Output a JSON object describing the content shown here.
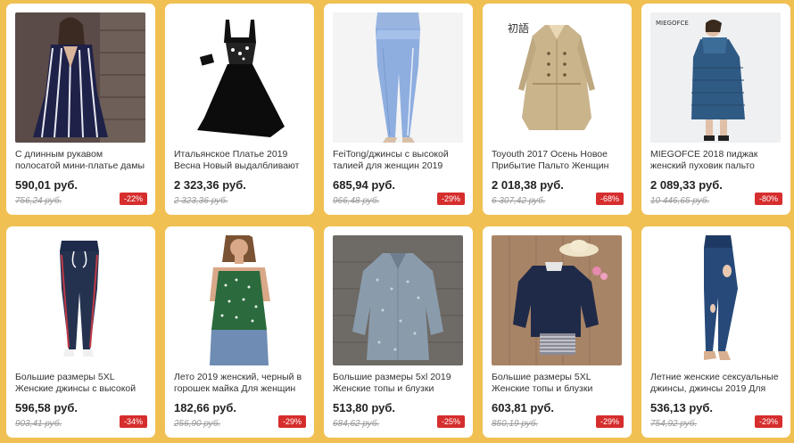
{
  "products": [
    {
      "title": "С длинным рукавом полосатой мини-платье дамы элегантных",
      "price": "590,01 руб.",
      "old_price": "756,24 руб.",
      "discount": "-22%",
      "image": "striped-dress"
    },
    {
      "title": "Итальянское Платье 2019 Весна Новый выдалбливают",
      "price": "2 323,36 руб.",
      "old_price": "2 323,36 руб.",
      "discount": "",
      "image": "black-dress"
    },
    {
      "title": "FeiTong/джинсы с высокой талией для женщин 2019",
      "price": "685,94 руб.",
      "old_price": "966,48 руб.",
      "discount": "-29%",
      "image": "light-jeans"
    },
    {
      "title": "Toyouth 2017 Осень Новое Прибытие Пальто Женщин",
      "price": "2 018,38 руб.",
      "old_price": "6 307,42 руб.",
      "discount": "-68%",
      "image": "trench-coat"
    },
    {
      "title": "MIEGOFCE 2018 пиджак женский пуховик пальто",
      "price": "2 089,33 руб.",
      "old_price": "10 446,65 руб.",
      "discount": "-80%",
      "image": "blue-coat"
    },
    {
      "title": "Большие размеры 5XL Женские джинсы с высокой",
      "price": "596,58 руб.",
      "old_price": "903,41 руб.",
      "discount": "-34%",
      "image": "dark-jeans"
    },
    {
      "title": "Лето 2019 женский, черный в горошек майка Для женщин",
      "price": "182,66 руб.",
      "old_price": "256,90 руб.",
      "discount": "-29%",
      "image": "green-top"
    },
    {
      "title": "Большие размеры 5xl 2019 Женские топы и блузки",
      "price": "513,80 руб.",
      "old_price": "684,62 руб.",
      "discount": "-25%",
      "image": "grey-blouse"
    },
    {
      "title": "Большие размеры 5XL Женские топы и блузки",
      "price": "603,81 руб.",
      "old_price": "850,19 руб.",
      "discount": "-29%",
      "image": "navy-top"
    },
    {
      "title": "Летние женские сексуальные джинсы, джинсы 2019 Для",
      "price": "536,13 руб.",
      "old_price": "754,92 руб.",
      "discount": "-29%",
      "image": "ripped-jeans"
    }
  ],
  "logos": {
    "trench_coat_logo": "初語",
    "blue_coat_logo": "MIEGOFCE"
  },
  "colors": {
    "background": "#f0c052",
    "badge": "#d62d2d"
  }
}
